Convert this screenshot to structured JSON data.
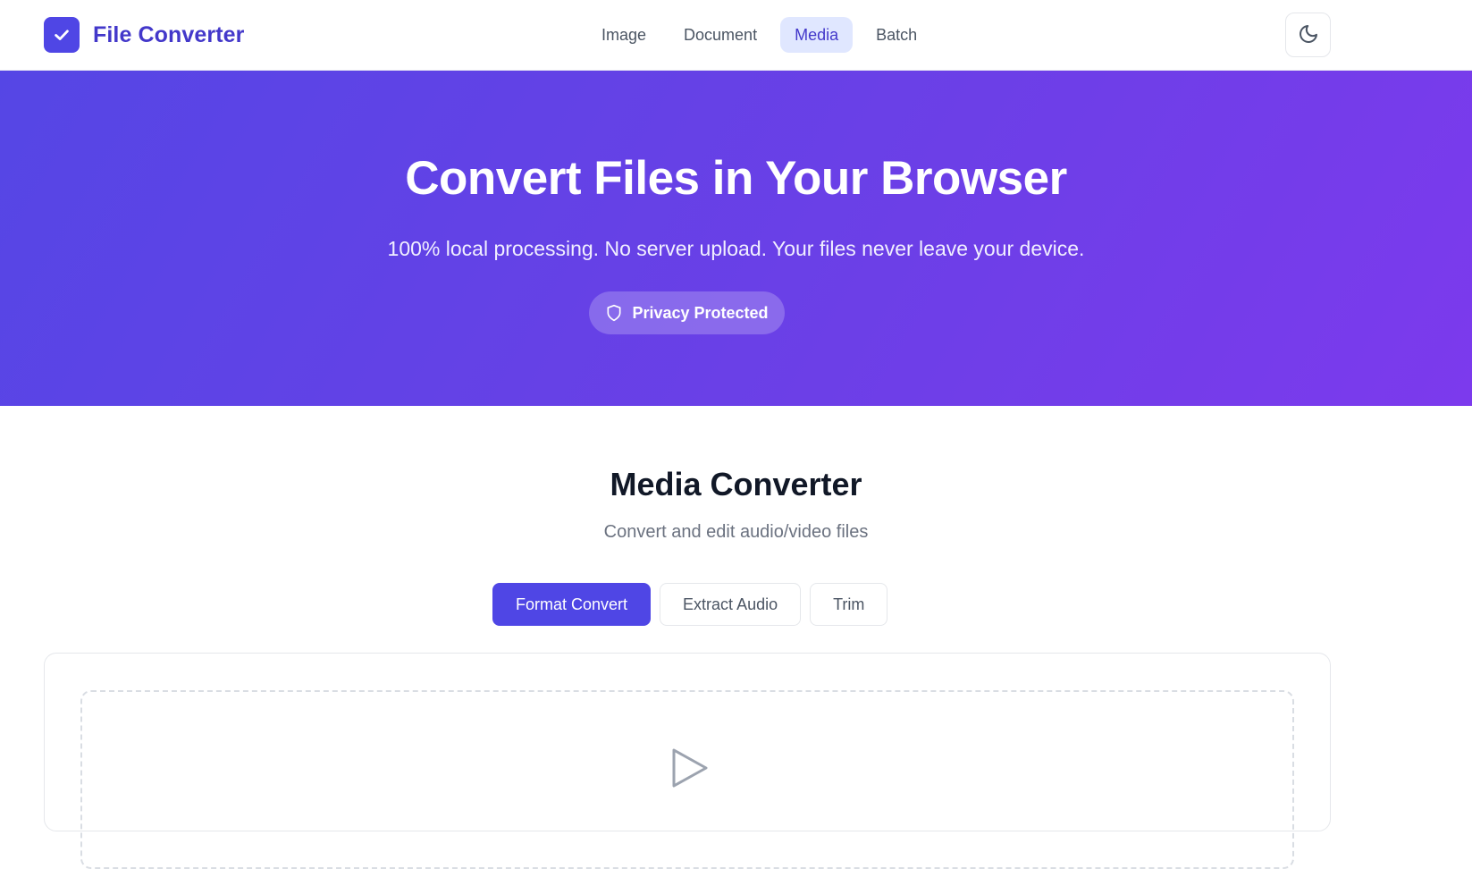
{
  "app": {
    "title": "File Converter",
    "logo_icon": "check-icon",
    "theme_icon": "moon-icon"
  },
  "nav": {
    "items": [
      {
        "label": "Image"
      },
      {
        "label": "Document"
      },
      {
        "label": "Media",
        "active": true
      },
      {
        "label": "Batch"
      }
    ]
  },
  "hero": {
    "title": "Convert Files in Your Browser",
    "subtitle": "100% local processing. No server upload. Your files never leave your device.",
    "badge": "Privacy Protected",
    "badge_icon": "shield-icon"
  },
  "section": {
    "title": "Media Converter",
    "subtitle": "Convert and edit audio/video files"
  },
  "tabs": [
    {
      "label": "Format Convert",
      "active": true
    },
    {
      "label": "Extract Audio"
    },
    {
      "label": "Trim"
    }
  ],
  "dropzone": {
    "icon": "play-icon"
  },
  "colors": {
    "accent": "#4f46e5",
    "hero_start": "#5546e5",
    "hero_end": "#7c3aed",
    "nav_active_bg": "#e0e7ff"
  }
}
